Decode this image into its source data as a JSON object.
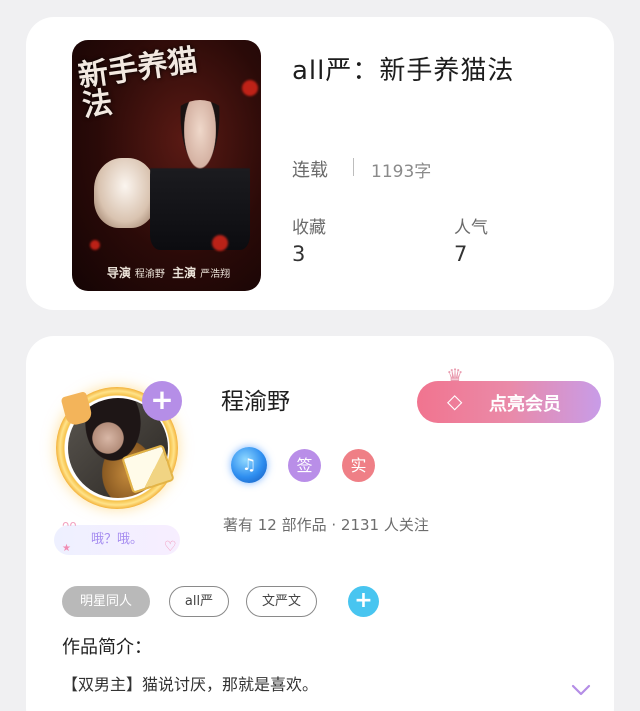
{
  "book": {
    "cover_title": "新手养猫法",
    "cover_credits": [
      "导演",
      "程渝野",
      "主演",
      "严浩翔"
    ],
    "title": "all严：新手养猫法",
    "status": "连载",
    "word_count": "1193字",
    "favorites_label": "收藏",
    "favorites_value": "3",
    "popularity_label": "人气",
    "popularity_value": "7"
  },
  "author": {
    "name": "程渝野",
    "follow_icon": "plus-icon",
    "mood": "哦？哦。",
    "vip_button_label": "点亮会员",
    "badges": [
      {
        "icon": "music-note-icon",
        "label": ""
      },
      {
        "icon": "sign-badge",
        "label": "签"
      },
      {
        "icon": "real-name-badge",
        "label": "实"
      }
    ],
    "stats": "著有 12 部作品 · 2131 人关注"
  },
  "tags": [
    {
      "label": "明星同人"
    },
    {
      "label": "all严"
    },
    {
      "label": "文严文"
    }
  ],
  "intro": {
    "heading": "作品简介：",
    "text": "【双男主】猫说讨厌，那就是喜欢。"
  },
  "colors": {
    "vip_start": "#f1748f",
    "vip_end": "#c89ce8",
    "follow_button": "#b58ee7",
    "tag_add": "#48c5f0",
    "badge_sign": "#b98ee8",
    "badge_real": "#ef7f86"
  }
}
